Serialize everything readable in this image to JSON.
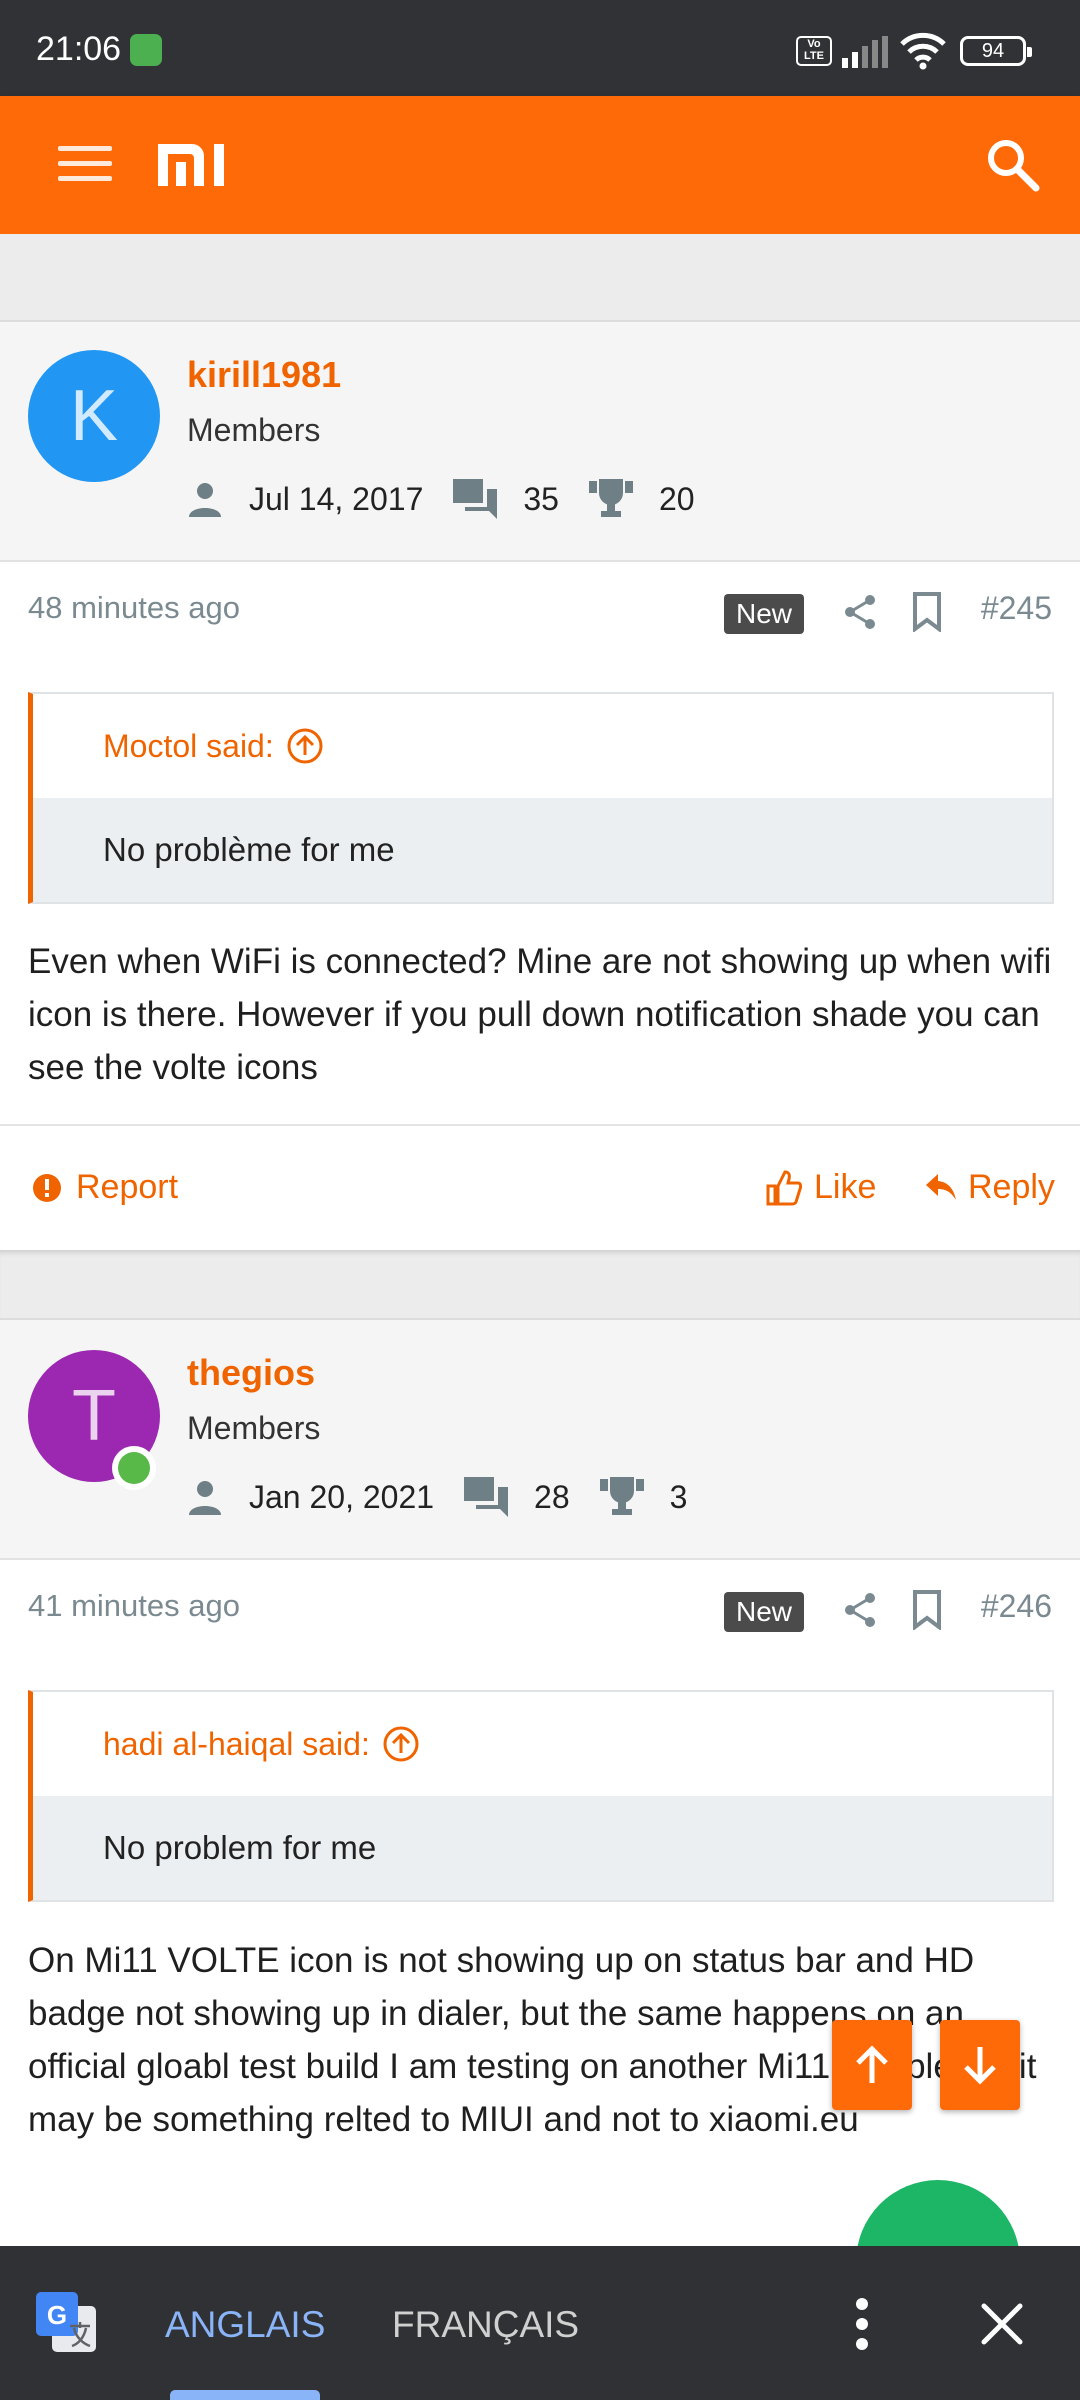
{
  "status_bar": {
    "time": "21:06",
    "volte": "Vo LTE",
    "battery": "94"
  },
  "app_bar": {
    "logo_text": "mi"
  },
  "posts": [
    {
      "avatar_letter": "K",
      "avatar_color": "#2196f3",
      "username": "kirill1981",
      "role": "Members",
      "joined": "Jul 14, 2017",
      "messages": "35",
      "reactions": "20",
      "time_ago": "48 minutes ago",
      "badge": "New",
      "post_number": "#245",
      "quote_author": "Moctol said:",
      "quote_text": "No problème for me",
      "body": "Even when WiFi is connected? Mine are not showing up when wifi icon is there. However if you pull down notification shade you can see the volte icons",
      "actions": {
        "report": "Report",
        "like": "Like",
        "reply": "Reply"
      }
    },
    {
      "avatar_letter": "T",
      "avatar_color": "#9c27b0",
      "username": "thegios",
      "role": "Members",
      "joined": "Jan 20, 2021",
      "messages": "28",
      "reactions": "3",
      "time_ago": "41 minutes ago",
      "badge": "New",
      "post_number": "#246",
      "quote_author": "hadi al-haiqal said:",
      "quote_text": "No problem for me",
      "body": "On Mi11 VOLTE icon is not showing up on status bar and HD badge not showing up in dialer, but the same happens on an official gloabl test build I am testing on another Mi11 sample, so it may be something relted to MIUI and not to xiaomi.eu"
    }
  ],
  "translate_bar": {
    "lang_source": "ANGLAIS",
    "lang_target": "FRANÇAIS"
  },
  "colors": {
    "accent": "#ff6a08",
    "link": "#f06400",
    "fab_green": "#1db566"
  }
}
